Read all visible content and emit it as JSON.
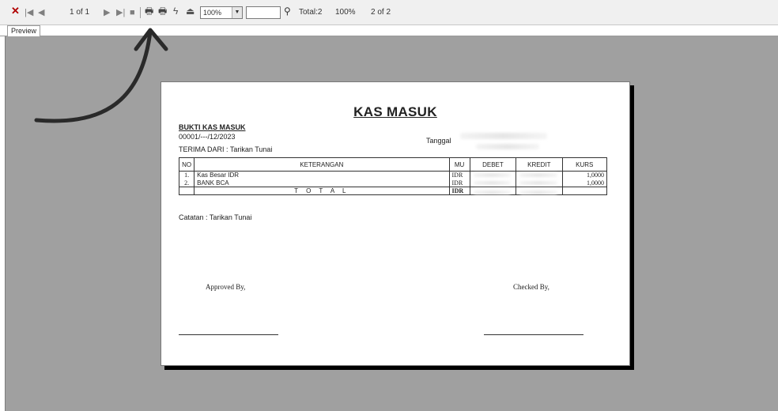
{
  "toolbar": {
    "page_indicator": "1 of 1",
    "zoom_value": "100%",
    "total_label": "Total:2",
    "percent_label": "100%",
    "record_label": "2 of 2"
  },
  "tabs": {
    "preview": "Preview"
  },
  "report": {
    "title": "KAS MASUK",
    "subtitle": "BUKTI KAS MASUK",
    "number": "00001/---/12/2023",
    "from": "TERIMA DARI :  Tarikan Tunai",
    "date_label": "Tanggal",
    "columns": [
      "NO",
      "KETERANGAN",
      "MU",
      "DEBET",
      "KREDIT",
      "KURS"
    ],
    "rows": [
      {
        "no": "1.",
        "keterangan": "Kas Besar IDR",
        "mu": "IDR",
        "kurs": "1,0000"
      },
      {
        "no": "2.",
        "keterangan": "BANK BCA",
        "mu": "IDR",
        "kurs": "1,0000"
      }
    ],
    "total_label": "T O T A L",
    "total_currency": "IDR",
    "note": "Catatan   : Tarikan Tunai",
    "approved_by": "Approved By,",
    "checked_by": "Checked By,"
  },
  "colors": {
    "canvas": "#a0a0a0",
    "toolbar": "#f0f0f0",
    "close": "#b00000"
  },
  "icons": [
    "close-icon",
    "first-page-icon",
    "previous-page-icon",
    "next-page-icon",
    "last-page-icon",
    "stop-icon",
    "print-icon",
    "print-setup-icon",
    "export-icon",
    "email-icon",
    "find-icon",
    "arrow-annotation"
  ]
}
